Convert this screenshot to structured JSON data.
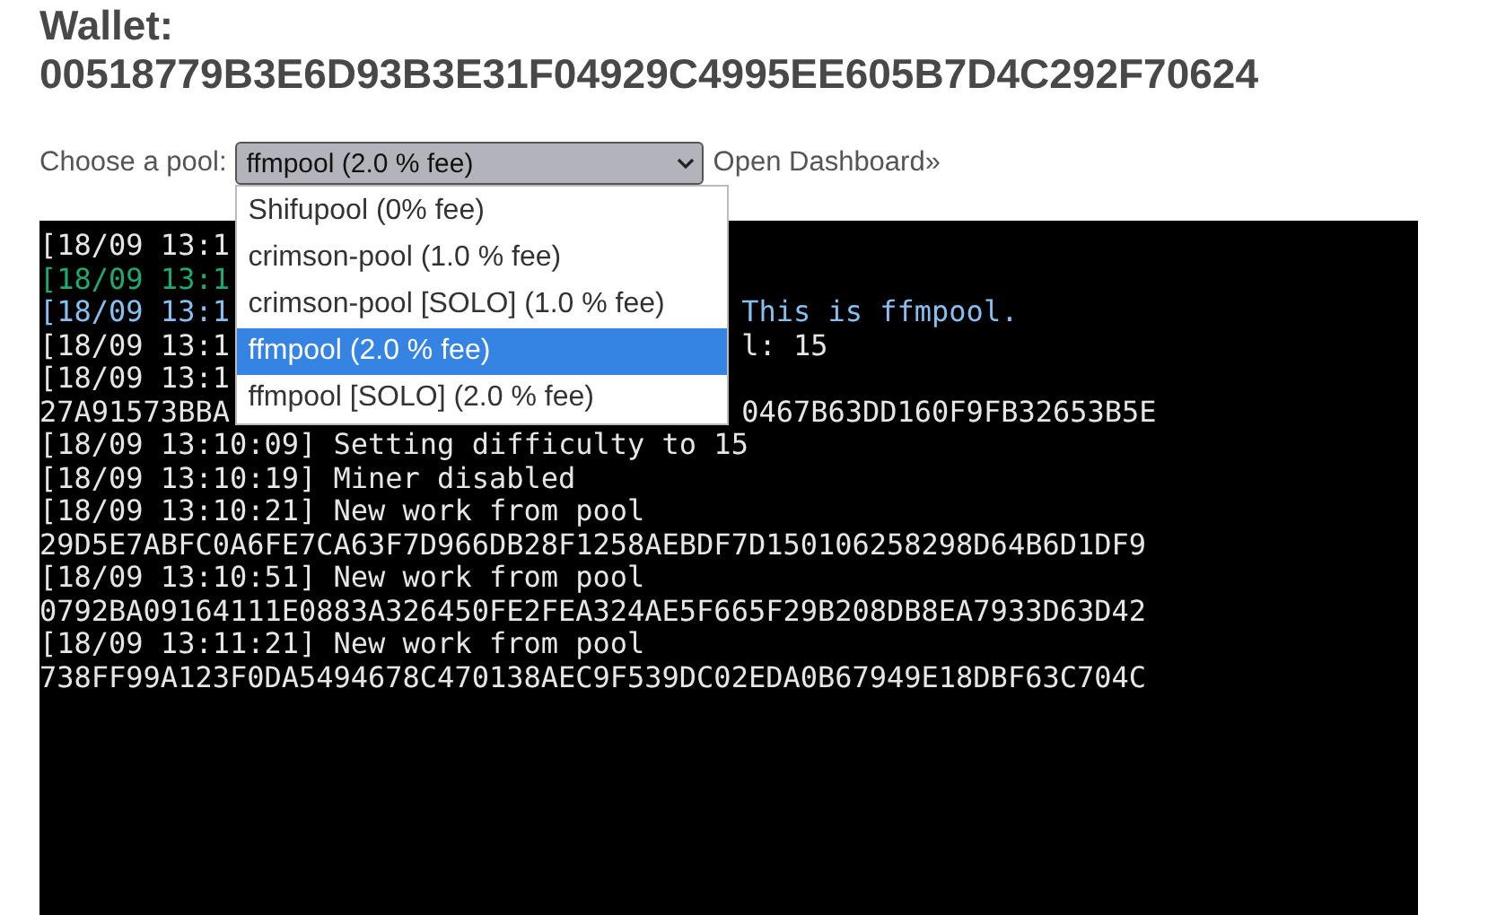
{
  "heading": {
    "label": "Wallet:",
    "value": "00518779B3E6D93B3E31F04929C4995EE605B7D4C292F70624"
  },
  "pool_picker": {
    "label": "Choose a pool:",
    "value": "ffmpool (2.0 % fee)",
    "expanded": true,
    "options": [
      {
        "label": "Shifupool (0% fee)",
        "selected": false
      },
      {
        "label": "crimson-pool (1.0 % fee)",
        "selected": false
      },
      {
        "label": "crimson-pool [SOLO] (1.0 % fee)",
        "selected": false
      },
      {
        "label": "ffmpool (2.0 % fee)",
        "selected": true
      },
      {
        "label": "ffmpool [SOLO] (2.0 % fee)",
        "selected": false
      }
    ]
  },
  "dashboard_link": "Open Dashboard»",
  "console": [
    {
      "left": "[18/09 13:1",
      "color": "#e6e6e6"
    },
    {
      "left": "[18/09 13:1",
      "color": "#1fa870"
    },
    {
      "left": "[18/09 13:1",
      "right": "This is ffmpool.",
      "color": "#86bff0"
    },
    {
      "left": "[18/09 13:1",
      "right": "l: 15",
      "color": "#e6e6e6"
    },
    {
      "left": "[18/09 13:1",
      "color": "#e6e6e6"
    },
    {
      "left": "27A91573BBA",
      "right": "0467B63DD160F9FB32653B5E",
      "color": "#e6e6e6"
    },
    {
      "left": "[18/09 13:10:09] Setting difficulty to 15",
      "color": "#e6e6e6"
    },
    {
      "left": "[18/09 13:10:19] Miner disabled",
      "color": "#e6e6e6"
    },
    {
      "left": "[18/09 13:10:21] New work from pool",
      "color": "#e6e6e6"
    },
    {
      "left": "29D5E7ABFC0A6FE7CA63F7D966DB28F1258AEBDF7D150106258298D64B6D1DF9",
      "color": "#e6e6e6"
    },
    {
      "left": "[18/09 13:10:51] New work from pool",
      "color": "#e6e6e6"
    },
    {
      "left": "0792BA09164111E0883A326450FE2FEA324AE5F665F29B208DB8EA7933D63D42",
      "color": "#e6e6e6"
    },
    {
      "left": "[18/09 13:11:21] New work from pool",
      "color": "#e6e6e6"
    },
    {
      "left": "738FF99A123F0DA5494678C470138AEC9F539DC02EDA0B67949E18DBF63C704C",
      "color": "#e6e6e6"
    }
  ]
}
